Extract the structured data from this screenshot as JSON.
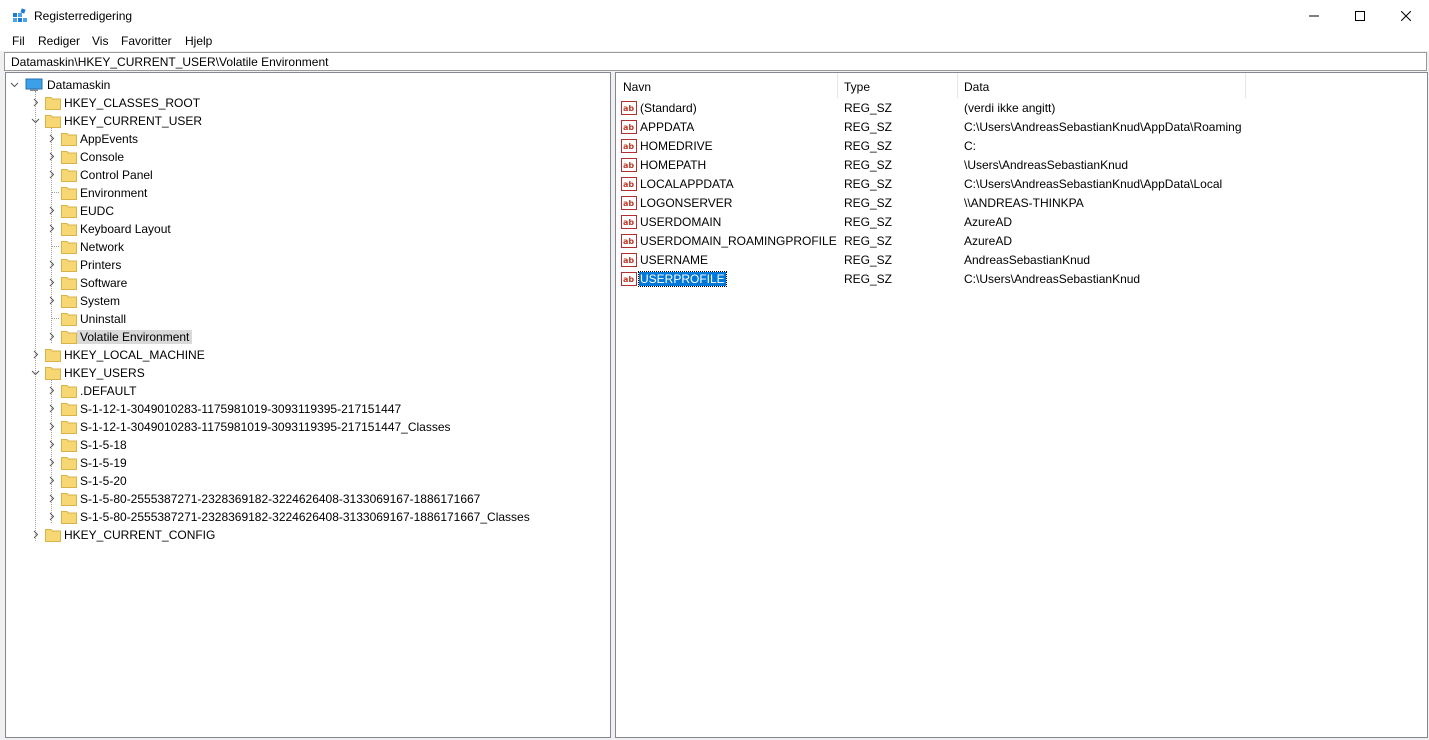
{
  "window": {
    "title": "Registerredigering"
  },
  "menu": [
    "Fil",
    "Rediger",
    "Vis",
    "Favoritter",
    "Hjelp"
  ],
  "address": "Datamaskin\\HKEY_CURRENT_USER\\Volatile Environment",
  "tree": {
    "root": "Datamaskin",
    "nodes": [
      {
        "label": "HKEY_CLASSES_ROOT"
      },
      {
        "label": "HKEY_CURRENT_USER"
      },
      {
        "label": "AppEvents"
      },
      {
        "label": "Console"
      },
      {
        "label": "Control Panel"
      },
      {
        "label": "Environment"
      },
      {
        "label": "EUDC"
      },
      {
        "label": "Keyboard Layout"
      },
      {
        "label": "Network"
      },
      {
        "label": "Printers"
      },
      {
        "label": "Software"
      },
      {
        "label": "System"
      },
      {
        "label": "Uninstall"
      },
      {
        "label": "Volatile Environment"
      },
      {
        "label": "HKEY_LOCAL_MACHINE"
      },
      {
        "label": "HKEY_USERS"
      },
      {
        "label": ".DEFAULT"
      },
      {
        "label": "S-1-12-1-3049010283-1175981019-3093119395-217151447"
      },
      {
        "label": "S-1-12-1-3049010283-1175981019-3093119395-217151447_Classes"
      },
      {
        "label": "S-1-5-18"
      },
      {
        "label": "S-1-5-19"
      },
      {
        "label": "S-1-5-20"
      },
      {
        "label": "S-1-5-80-2555387271-2328369182-3224626408-3133069167-1886171667"
      },
      {
        "label": "S-1-5-80-2555387271-2328369182-3224626408-3133069167-1886171667_Classes"
      },
      {
        "label": "HKEY_CURRENT_CONFIG"
      }
    ]
  },
  "list": {
    "columns": [
      "Navn",
      "Type",
      "Data"
    ],
    "rows": [
      {
        "name": "(Standard)",
        "type": "REG_SZ",
        "data": "(verdi ikke angitt)"
      },
      {
        "name": "APPDATA",
        "type": "REG_SZ",
        "data": "C:\\Users\\AndreasSebastianKnud\\AppData\\Roaming"
      },
      {
        "name": "HOMEDRIVE",
        "type": "REG_SZ",
        "data": "C:"
      },
      {
        "name": "HOMEPATH",
        "type": "REG_SZ",
        "data": "\\Users\\AndreasSebastianKnud"
      },
      {
        "name": "LOCALAPPDATA",
        "type": "REG_SZ",
        "data": "C:\\Users\\AndreasSebastianKnud\\AppData\\Local"
      },
      {
        "name": "LOGONSERVER",
        "type": "REG_SZ",
        "data": "\\\\ANDREAS-THINKPA"
      },
      {
        "name": "USERDOMAIN",
        "type": "REG_SZ",
        "data": "AzureAD"
      },
      {
        "name": "USERDOMAIN_ROAMINGPROFILE",
        "type": "REG_SZ",
        "data": "AzureAD"
      },
      {
        "name": "USERNAME",
        "type": "REG_SZ",
        "data": "AndreasSebastianKnud"
      },
      {
        "name": "USERPROFILE",
        "type": "REG_SZ",
        "data": "C:\\Users\\AndreasSebastianKnud"
      }
    ]
  },
  "colors": {
    "selection": "#0078d7",
    "folder": "#f7d674",
    "tree_selected": "#d9d9d9"
  }
}
